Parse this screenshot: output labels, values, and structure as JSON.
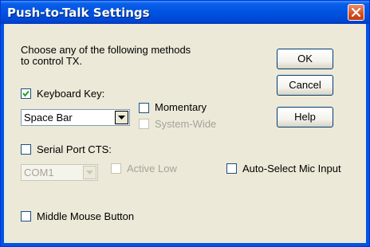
{
  "window": {
    "title": "Push-to-Talk Settings"
  },
  "instructions": [
    "Choose any of the following methods",
    "to control TX."
  ],
  "buttons": {
    "ok": "OK",
    "cancel": "Cancel",
    "help": "Help"
  },
  "keyboard": {
    "label": "Keyboard Key:",
    "checked": true,
    "key_value": "Space Bar",
    "momentary_label": "Momentary",
    "system_wide_label": "System-Wide"
  },
  "serial": {
    "label": "Serial Port CTS:",
    "checked": false,
    "port_value": "COM1",
    "active_low_label": "Active Low"
  },
  "auto_select": {
    "label": "Auto-Select Mic Input",
    "checked": false
  },
  "middle_mouse": {
    "label": "Middle Mouse Button",
    "checked": false
  }
}
